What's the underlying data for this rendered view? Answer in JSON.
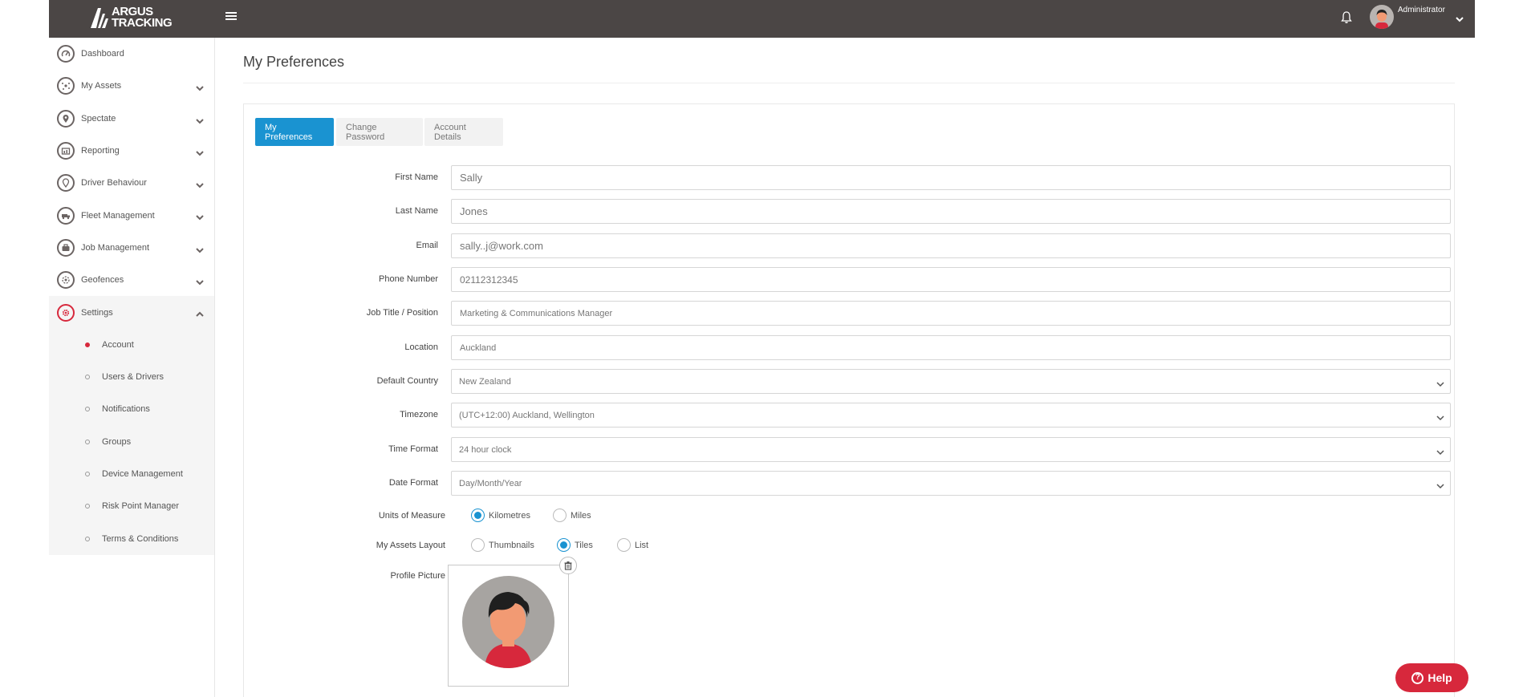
{
  "header": {
    "logo_line1": "ARGUS",
    "logo_line2": "TRACKING",
    "user_name": "Administrator"
  },
  "sidebar": {
    "items": [
      {
        "label": "Dashboard",
        "icon": "dashboard-icon"
      },
      {
        "label": "My Assets",
        "icon": "assets-icon"
      },
      {
        "label": "Spectate",
        "icon": "map-pin-icon"
      },
      {
        "label": "Reporting",
        "icon": "report-icon"
      },
      {
        "label": "Driver Behaviour",
        "icon": "driver-icon"
      },
      {
        "label": "Fleet Management",
        "icon": "fleet-icon"
      },
      {
        "label": "Job Management",
        "icon": "briefcase-icon"
      },
      {
        "label": "Geofences",
        "icon": "geofence-icon"
      },
      {
        "label": "Settings",
        "icon": "gear-icon"
      }
    ],
    "settings_sub": [
      {
        "label": "Account"
      },
      {
        "label": "Users & Drivers"
      },
      {
        "label": "Notifications"
      },
      {
        "label": "Groups"
      },
      {
        "label": "Device Management"
      },
      {
        "label": "Risk Point Manager"
      },
      {
        "label": "Terms & Conditions"
      }
    ]
  },
  "main": {
    "title": "My Preferences",
    "tabs": [
      "My Preferences",
      "Change Password",
      "Account Details"
    ],
    "fields": {
      "first_name": {
        "label": "First Name",
        "value": "Sally"
      },
      "last_name": {
        "label": "Last Name",
        "value": "Jones"
      },
      "email": {
        "label": "Email",
        "value": "sally..j@work.com"
      },
      "phone": {
        "label": "Phone Number",
        "value": "02112312345"
      },
      "job_title": {
        "label": "Job Title / Position",
        "value": "Marketing & Communications Manager"
      },
      "location": {
        "label": "Location",
        "value": "Auckland"
      },
      "country": {
        "label": "Default Country",
        "value": "New Zealand"
      },
      "timezone": {
        "label": "Timezone",
        "value": "(UTC+12:00) Auckland, Wellington"
      },
      "time_format": {
        "label": "Time Format",
        "value": "24 hour clock"
      },
      "date_format": {
        "label": "Date Format",
        "value": "Day/Month/Year"
      }
    },
    "units": {
      "label": "Units of Measure",
      "options": [
        "Kilometres",
        "Miles"
      ],
      "selected": "Kilometres"
    },
    "layout": {
      "label": "My Assets Layout",
      "options": [
        "Thumbnails",
        "Tiles",
        "List"
      ],
      "selected": "Tiles"
    },
    "profile_picture_label": "Profile Picture"
  },
  "help": {
    "label": "Help"
  },
  "colors": {
    "topbar": "#4b4645",
    "accent": "#1a93d1",
    "brand_red": "#d7283c"
  }
}
